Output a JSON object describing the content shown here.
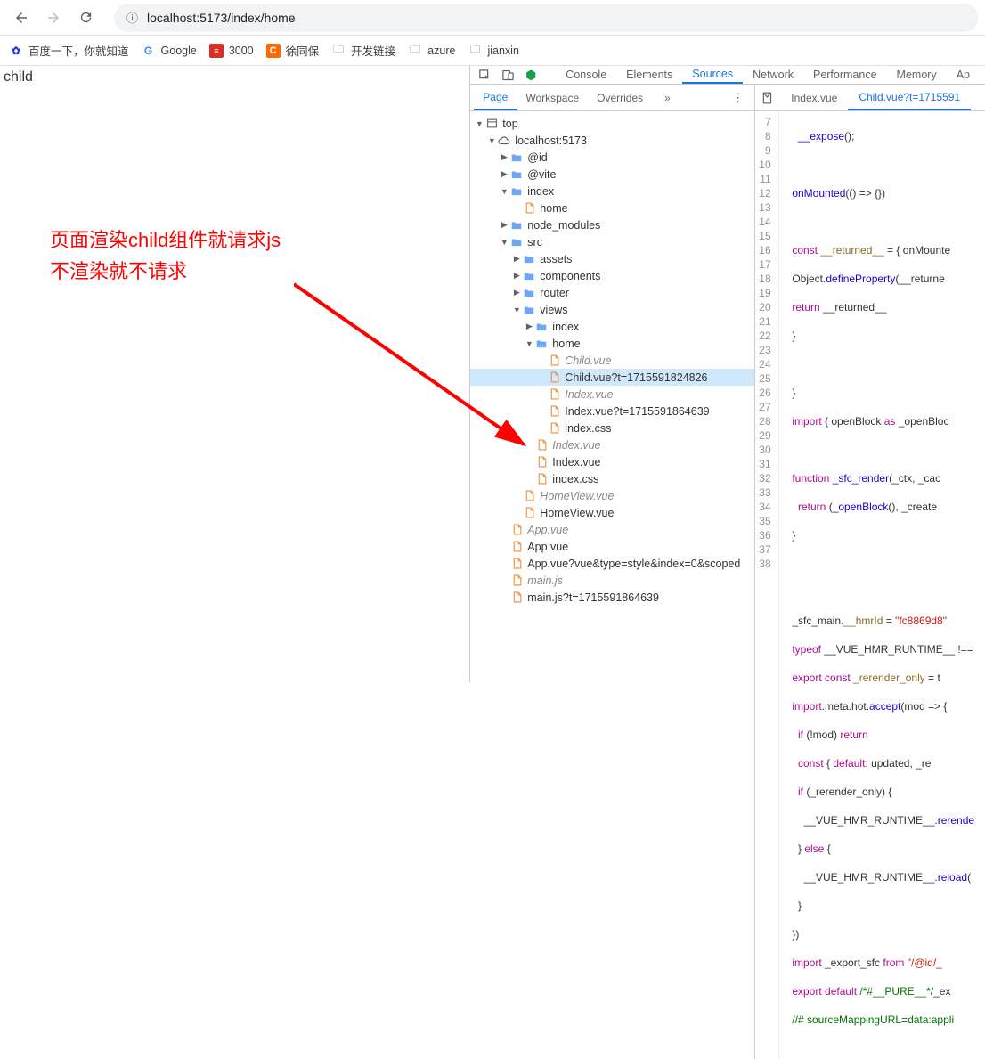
{
  "url": "localhost:5173/index/home",
  "bookmarks": [
    {
      "label": "百度一下，你就知道"
    },
    {
      "label": "Google"
    },
    {
      "label": "3000"
    },
    {
      "label": "徐同保"
    },
    {
      "label": "开发链接"
    },
    {
      "label": "azure"
    },
    {
      "label": "jianxin"
    }
  ],
  "page": {
    "text": "child"
  },
  "annotation": {
    "line1": "页面渲染child组件就请求js",
    "line2": "不渲染就不请求"
  },
  "devtools": {
    "tabs": [
      "Console",
      "Elements",
      "Sources",
      "Network",
      "Performance",
      "Memory",
      "Ap"
    ],
    "activeTab": "Sources",
    "subtabs": [
      "Page",
      "Workspace",
      "Overrides"
    ],
    "activeSub": "Page",
    "rightTabs": {
      "t1": "Index.vue",
      "t2": "Child.vue?t=1715591"
    },
    "tree": {
      "top": "top",
      "host": "localhost:5173",
      "id": "@id",
      "vite": "@vite",
      "index": "index",
      "home_file": "home",
      "node_modules": "node_modules",
      "src": "src",
      "assets": "assets",
      "components": "components",
      "router": "router",
      "views": "views",
      "v_index": "index",
      "v_home": "home",
      "child_vue": "Child.vue",
      "child_vue_t": "Child.vue?t=1715591824826",
      "index_vue1": "Index.vue",
      "index_vue_t": "Index.vue?t=1715591864639",
      "index_css1": "index.css",
      "index_vue2": "Index.vue",
      "index_vue3": "Index.vue",
      "index_css2": "index.css",
      "homeview1": "HomeView.vue",
      "homeview2": "HomeView.vue",
      "app_vue1": "App.vue",
      "app_vue2": "App.vue",
      "app_vue_q": "App.vue?vue&type=style&index=0&scoped",
      "main_js": "main.js",
      "main_js_t": "main.js?t=1715591864639"
    },
    "gutter": [
      "7",
      "8",
      "9",
      "10",
      "11",
      "12",
      "13",
      "14",
      "15",
      "16",
      "17",
      "18",
      "19",
      "20",
      "21",
      "22",
      "23",
      "24",
      "25",
      "26",
      "27",
      "28",
      "29",
      "30",
      "31",
      "32",
      "33",
      "34",
      "35",
      "36",
      "37",
      "38"
    ]
  },
  "chart_data": null
}
